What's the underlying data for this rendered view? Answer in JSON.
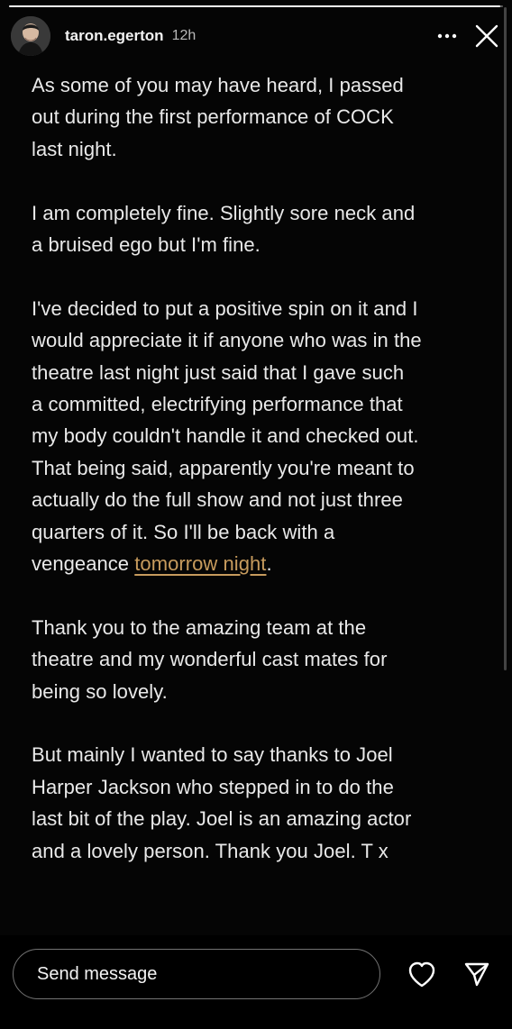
{
  "story": {
    "progress": 0.995
  },
  "header": {
    "username": "taron.egerton",
    "time_ago": "12h",
    "avatar_icon": "avatar-photo-icon",
    "more_icon": "ellipsis-icon",
    "close_icon": "close-icon"
  },
  "content": {
    "lines": [
      "As some of you may have heard, I passed",
      "out during the first performance of COCK",
      "last night.",
      "I am completely fine. Slightly sore neck and",
      "a bruised ego but I'm fine.",
      "I've decided to put a positive spin on it and I",
      "would appreciate it if anyone who was in the",
      "theatre last night just said that I gave such",
      "a committed, electrifying performance that",
      "my body couldn't handle it and checked out.",
      "That being said, apparently you're meant to",
      "actually do the full show and not just three",
      "quarters of it. So I'll be back with a",
      "vengeance ",
      "tomorrow night",
      ".",
      "Thank you to the amazing team at the",
      "theatre and my wonderful cast mates for",
      "being so lovely.",
      "But mainly I wanted to say thanks to Joel",
      "Harper Jackson who stepped in to do the",
      "last bit of the play. Joel is an amazing actor",
      "and a lovely person. Thank you Joel. T x"
    ],
    "link_color": "#c79b5d"
  },
  "footer": {
    "message_placeholder": "Send message",
    "heart_icon": "heart-icon",
    "send_icon": "send-icon"
  }
}
